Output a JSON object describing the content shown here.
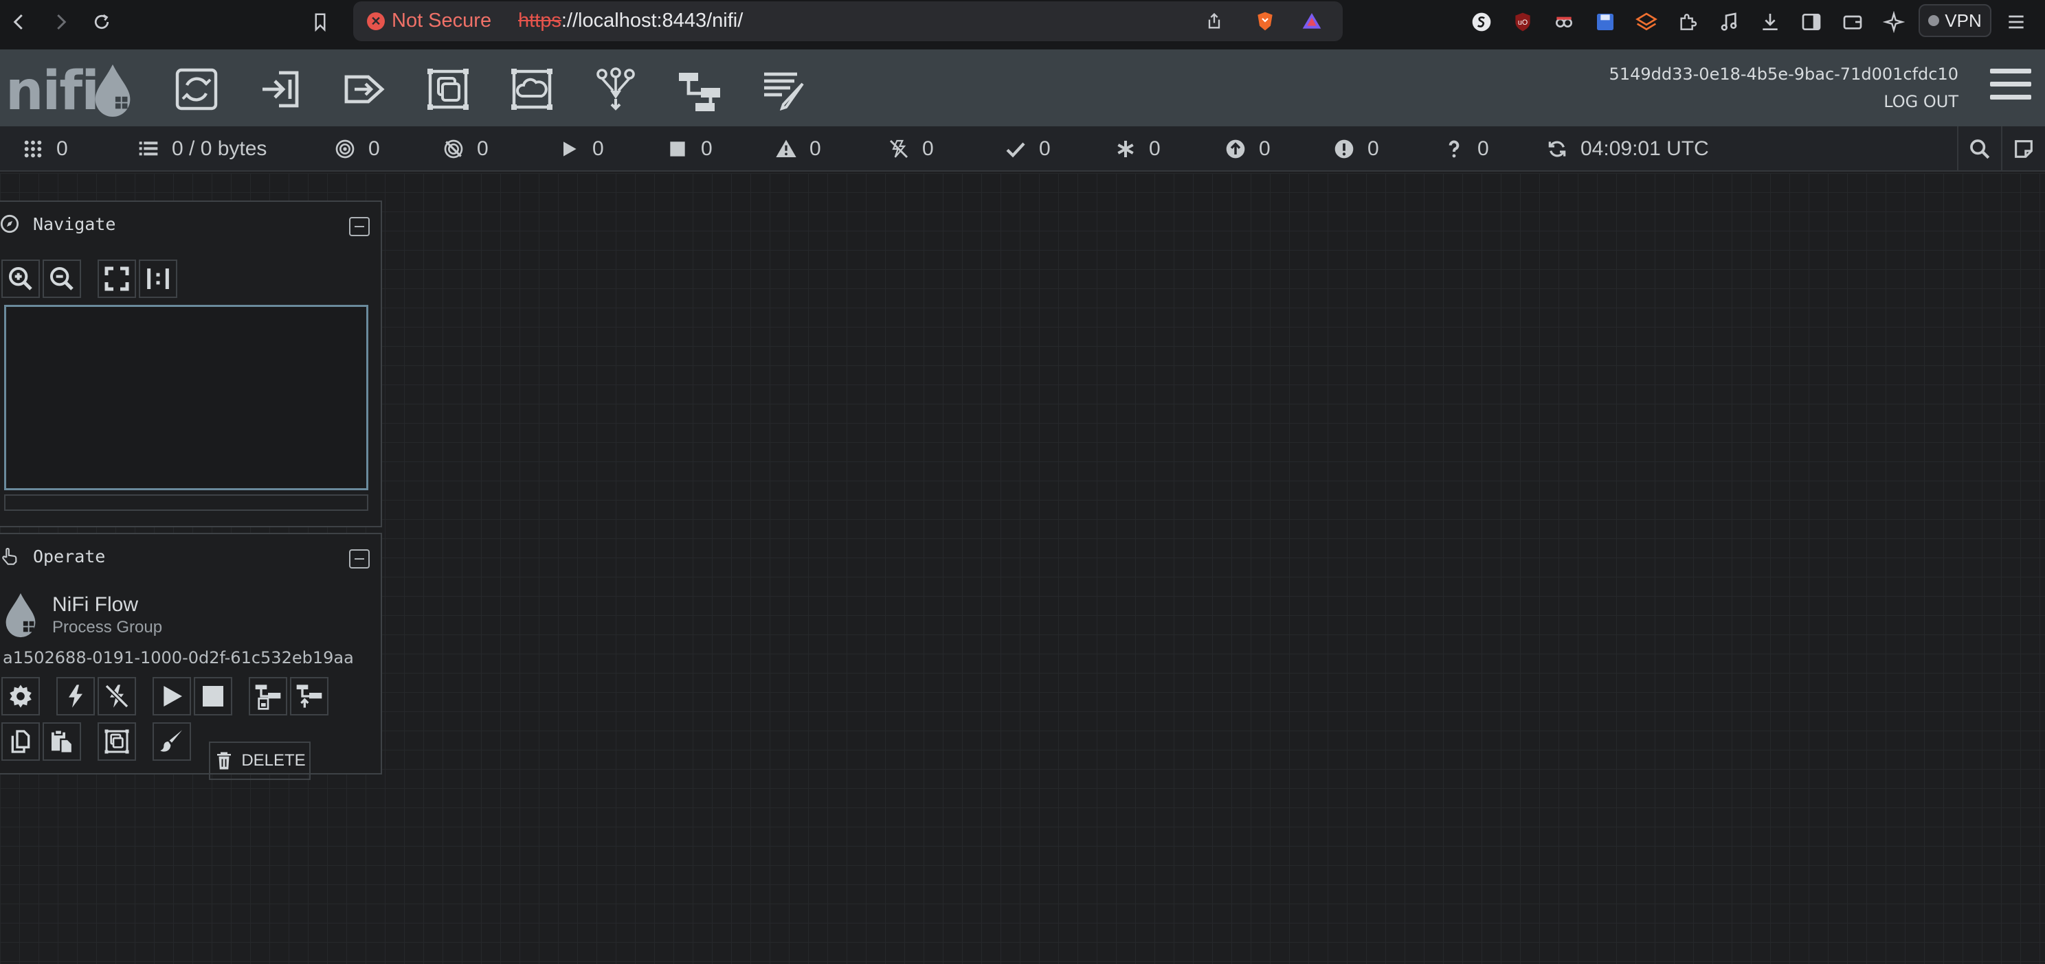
{
  "browser": {
    "security_label": "Not Secure",
    "url_scheme": "https",
    "url_rest": "://localhost:8443/nifi/",
    "vpn_label": "VPN"
  },
  "header": {
    "logo_text": "nifi",
    "user_identity": "5149dd33-0e18-4b5e-9bac-71d001cfdc10",
    "logout_label": "LOG OUT",
    "toolbar": [
      "processor-icon",
      "input-port-icon",
      "output-port-icon",
      "process-group-icon",
      "remote-process-group-icon",
      "funnel-icon",
      "template-icon",
      "label-icon"
    ]
  },
  "status": {
    "active_threads": "0",
    "queued": "0 / 0 bytes",
    "transmitting": "0",
    "not_transmitting": "0",
    "running": "0",
    "stopped": "0",
    "invalid": "0",
    "disabled": "0",
    "up_to_date": "0",
    "locally_modified": "0",
    "stale": "0",
    "locally_modified_stale": "0",
    "sync_failure": "0",
    "refresh_time": "04:09:01 UTC"
  },
  "navigate": {
    "title": "Navigate"
  },
  "operate": {
    "title": "Operate",
    "component_name": "NiFi Flow",
    "component_type": "Process Group",
    "component_id": "a1502688-0191-1000-0d2f-61c532eb19aa",
    "delete_label": "DELETE"
  },
  "colors": {
    "header_bg": "#3b4247",
    "canvas_bg": "#1d1e20",
    "not_secure": "#e6544c",
    "birdseye_border": "#6a8a9c"
  }
}
